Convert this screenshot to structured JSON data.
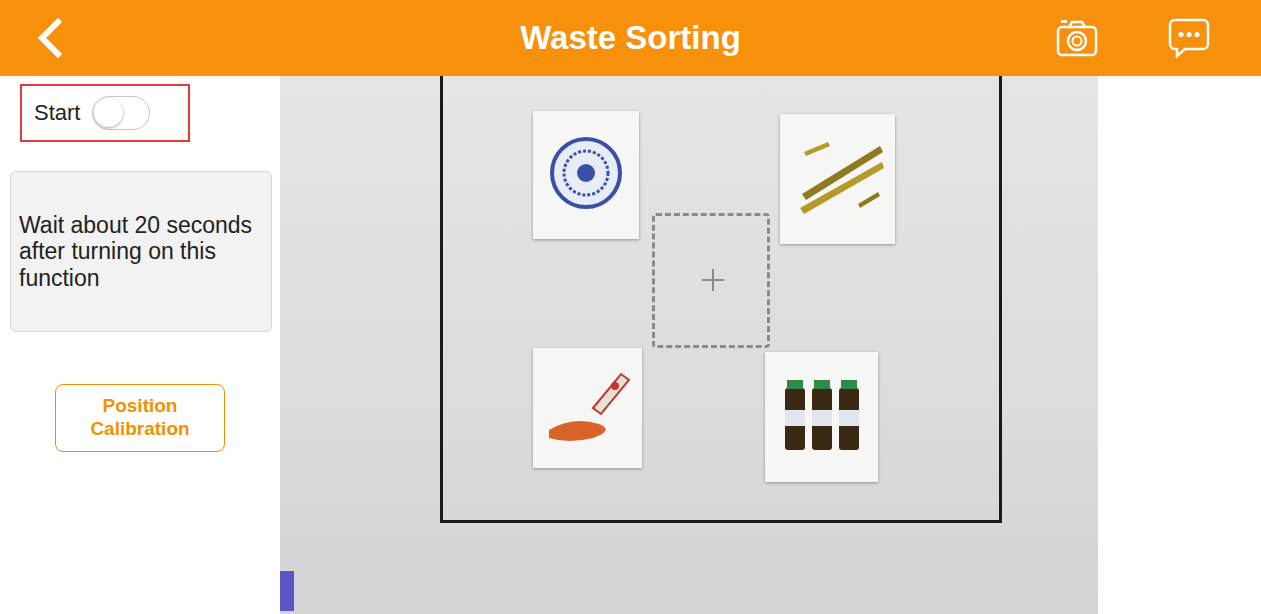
{
  "header": {
    "title": "Waste Sorting"
  },
  "start": {
    "label": "Start",
    "on": false
  },
  "notice": "Wait about 20 seconds after turning on this function",
  "buttons": [
    "Position Calibration"
  ]
}
